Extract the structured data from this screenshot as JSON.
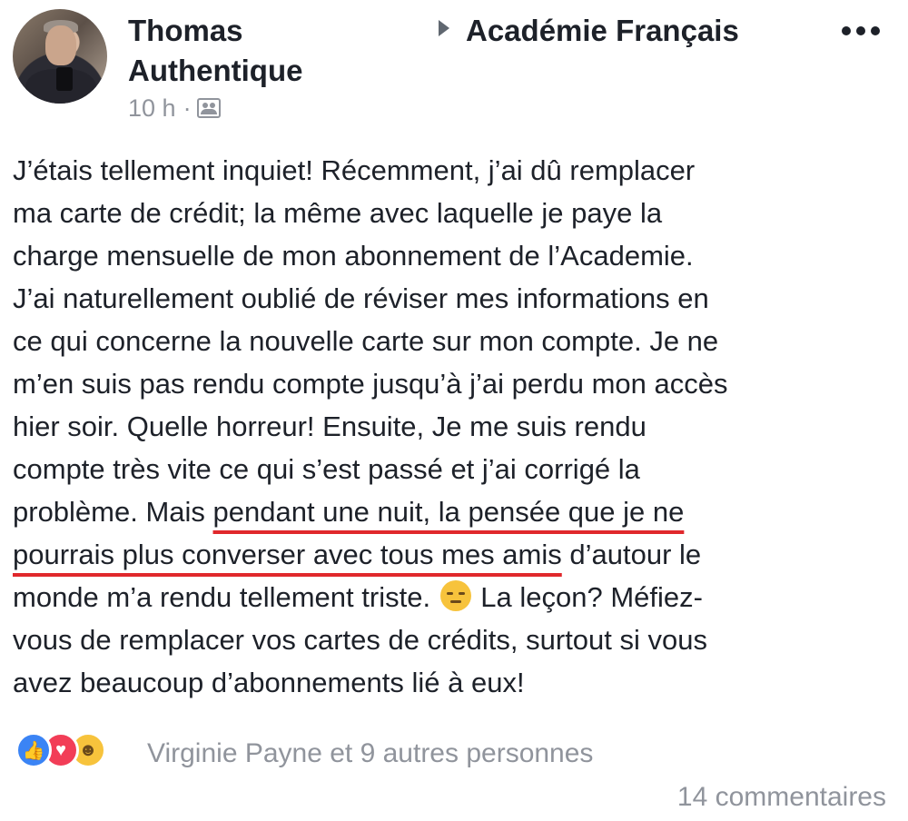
{
  "post": {
    "author": "Thomas Authentique",
    "group": "Académie Français",
    "time": "10 h",
    "separator": "·",
    "lines": [
      "J’étais tellement inquiet! Récemment, j’ai dû remplacer",
      "ma carte de crédit; la même avec laquelle je paye la",
      "charge mensuelle de mon abonnement de l’Academie.",
      "J’ai naturellement oublié de réviser mes informations en",
      "ce qui concerne la nouvelle carte sur mon compte. Je ne",
      "m’en suis pas rendu compte jusqu’à j’ai perdu mon accès",
      "hier soir. Quelle horreur! Ensuite, Je me suis rendu",
      "compte très vite ce qui s’est passé et j’ai corrigé la"
    ],
    "line9_pre": "problème. Mais ",
    "line9_hl": "pendant une nuit, la pensée que je ne",
    "line10_hl": "pourrais plus converser avec tous mes amis",
    "line10_post": " d’autour le",
    "line11_pre": "monde m’a rendu tellement triste. ",
    "line11_post": " La leçon? Méfiez-",
    "line12": "vous de remplacer vos cartes de crédits, surtout si vous",
    "line13": "avez beaucoup d’abonnements lié à eux!"
  },
  "icons": {
    "audience": "group-audience-icon",
    "more": "more-options-icon",
    "emoji": "pensive-face-emoji",
    "reactions": [
      "like-icon",
      "love-icon",
      "haha-icon"
    ]
  },
  "footer": {
    "reactions_text": "Virginie Payne et 9 autres personnes",
    "comments": "14 commentaires"
  },
  "colors": {
    "text": "#1d2129",
    "meta": "#90949c",
    "underline": "#e0282c",
    "like": "#3b84f5",
    "love": "#f23d57",
    "haha": "#f7c33c"
  }
}
